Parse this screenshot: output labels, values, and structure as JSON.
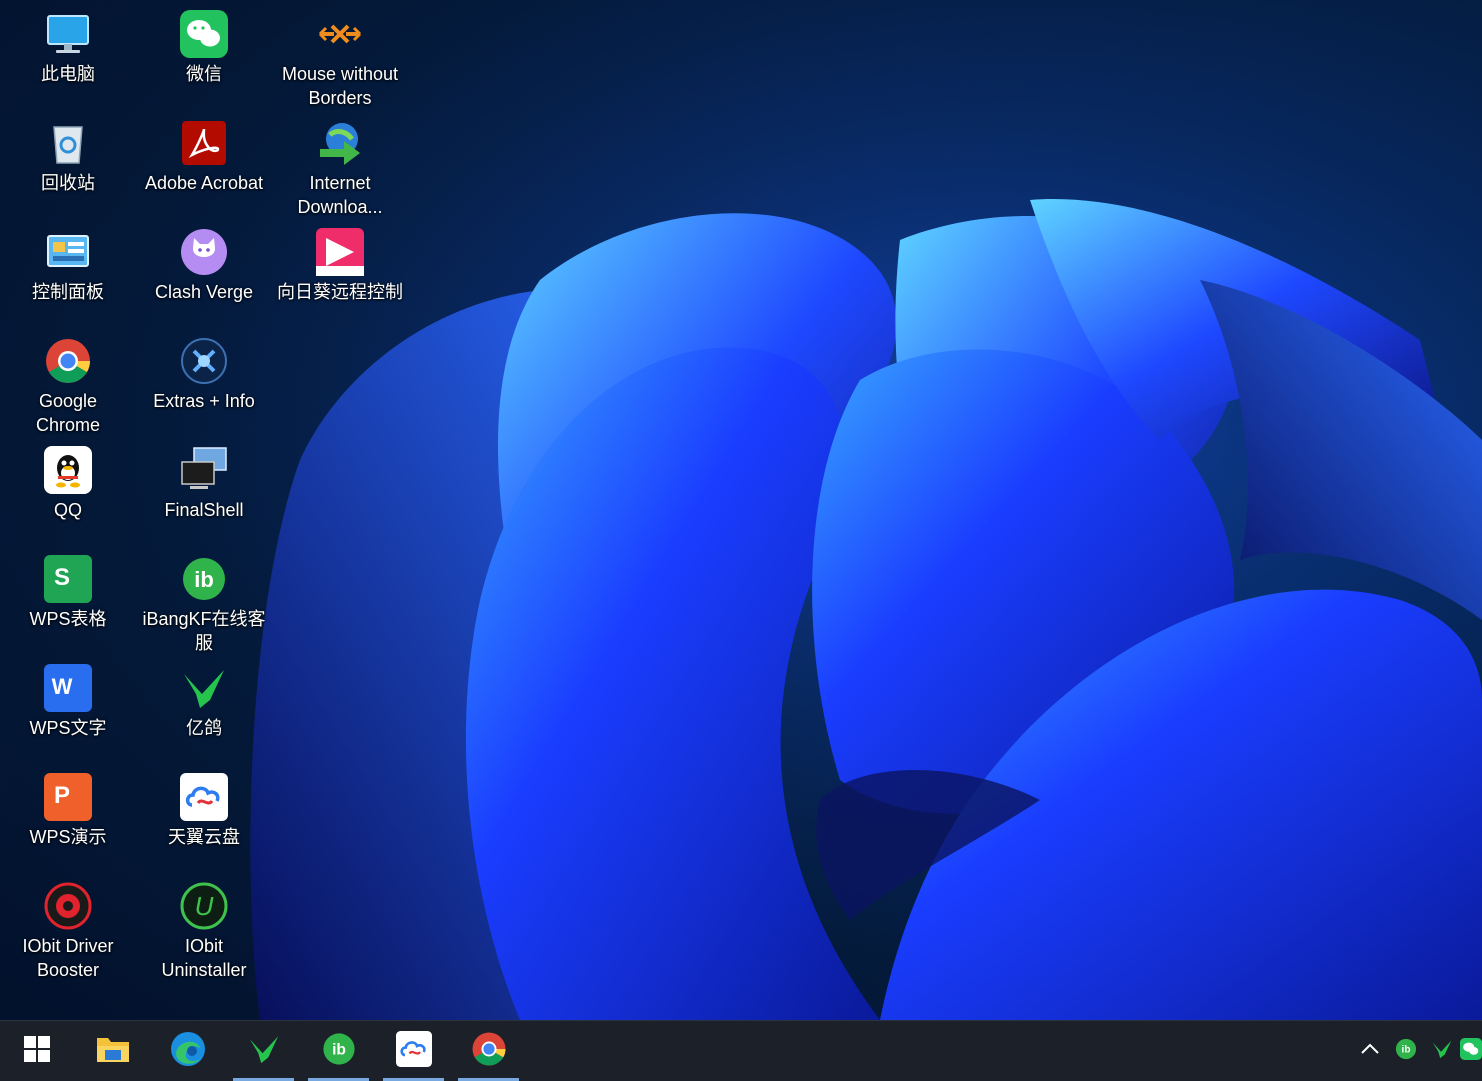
{
  "desktop": {
    "icons": [
      {
        "label": "此电脑",
        "icon": "this-pc-icon"
      },
      {
        "label": "回收站",
        "icon": "recycle-bin-icon"
      },
      {
        "label": "控制面板",
        "icon": "control-panel-icon"
      },
      {
        "label": "Google Chrome",
        "icon": "chrome-icon"
      },
      {
        "label": "QQ",
        "icon": "qq-icon"
      },
      {
        "label": "WPS表格",
        "icon": "wps-sheets-icon"
      },
      {
        "label": "WPS文字",
        "icon": "wps-writer-icon"
      },
      {
        "label": "WPS演示",
        "icon": "wps-presentation-icon"
      },
      {
        "label": "IObit Driver Booster",
        "icon": "driver-booster-icon"
      },
      {
        "label": "微信",
        "icon": "wechat-icon"
      },
      {
        "label": "Adobe Acrobat",
        "icon": "acrobat-icon"
      },
      {
        "label": "Clash Verge",
        "icon": "clash-verge-icon"
      },
      {
        "label": "Extras + Info",
        "icon": "extras-info-icon"
      },
      {
        "label": "FinalShell",
        "icon": "finalshell-icon"
      },
      {
        "label": "iBangKF在线客服",
        "icon": "ibangkf-icon"
      },
      {
        "label": "亿鸽",
        "icon": "yige-icon"
      },
      {
        "label": "天翼云盘",
        "icon": "tianyi-cloud-icon"
      },
      {
        "label": "IObit Uninstaller",
        "icon": "iobit-uninstaller-icon"
      },
      {
        "label": "Mouse without Borders",
        "icon": "mouse-without-borders-icon"
      },
      {
        "label": "Internet Downloa...",
        "icon": "internet-download-manager-icon"
      },
      {
        "label": "向日葵远程控制",
        "icon": "sunlogin-icon"
      }
    ]
  },
  "taskbar": {
    "pinned": [
      {
        "icon": "windows-start-icon",
        "active": false
      },
      {
        "icon": "file-explorer-icon",
        "active": false
      },
      {
        "icon": "edge-icon",
        "active": false
      },
      {
        "icon": "yige-icon",
        "active": true
      },
      {
        "icon": "ibangkf-icon",
        "active": true
      },
      {
        "icon": "tianyi-cloud-icon",
        "active": true
      },
      {
        "icon": "chrome-icon",
        "active": true
      }
    ],
    "tray": [
      {
        "icon": "chevron-up-icon"
      },
      {
        "icon": "ibangkf-icon"
      },
      {
        "icon": "yige-icon"
      },
      {
        "icon": "wechat-icon"
      }
    ]
  },
  "colors": {
    "taskbar_bg": "#1b2029",
    "active_indicator": "#78a8e0",
    "wallpaper_accent": "#1f4dff"
  }
}
